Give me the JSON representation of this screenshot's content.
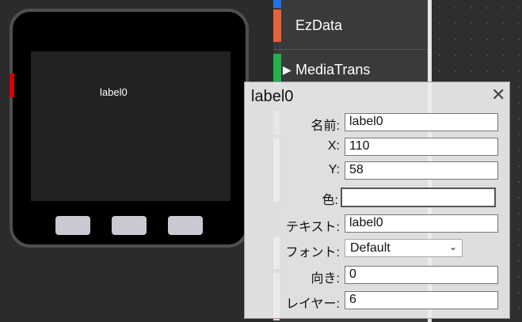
{
  "device": {
    "screen_label": "label0"
  },
  "sidebar": {
    "items": [
      {
        "label": "EzData",
        "color": "#e8613c"
      },
      {
        "label": "MediaTrans",
        "color": "#22b14c",
        "expandable": true
      }
    ]
  },
  "dialog": {
    "title": "label0",
    "close_icon": "close-icon",
    "fields": {
      "name_label": "名前:",
      "name_value": "label0",
      "x_label": "X:",
      "x_value": "110",
      "y_label": "Y:",
      "y_value": "58",
      "color_label": "色:",
      "text_label": "テキスト:",
      "text_value": "label0",
      "font_label": "フォント:",
      "font_value": "Default",
      "direction_label": "向き:",
      "direction_value": "0",
      "layer_label": "レイヤー:",
      "layer_value": "6"
    }
  },
  "colors": {
    "device_button": "#d40000",
    "accent_blue": "#1e73e8"
  }
}
